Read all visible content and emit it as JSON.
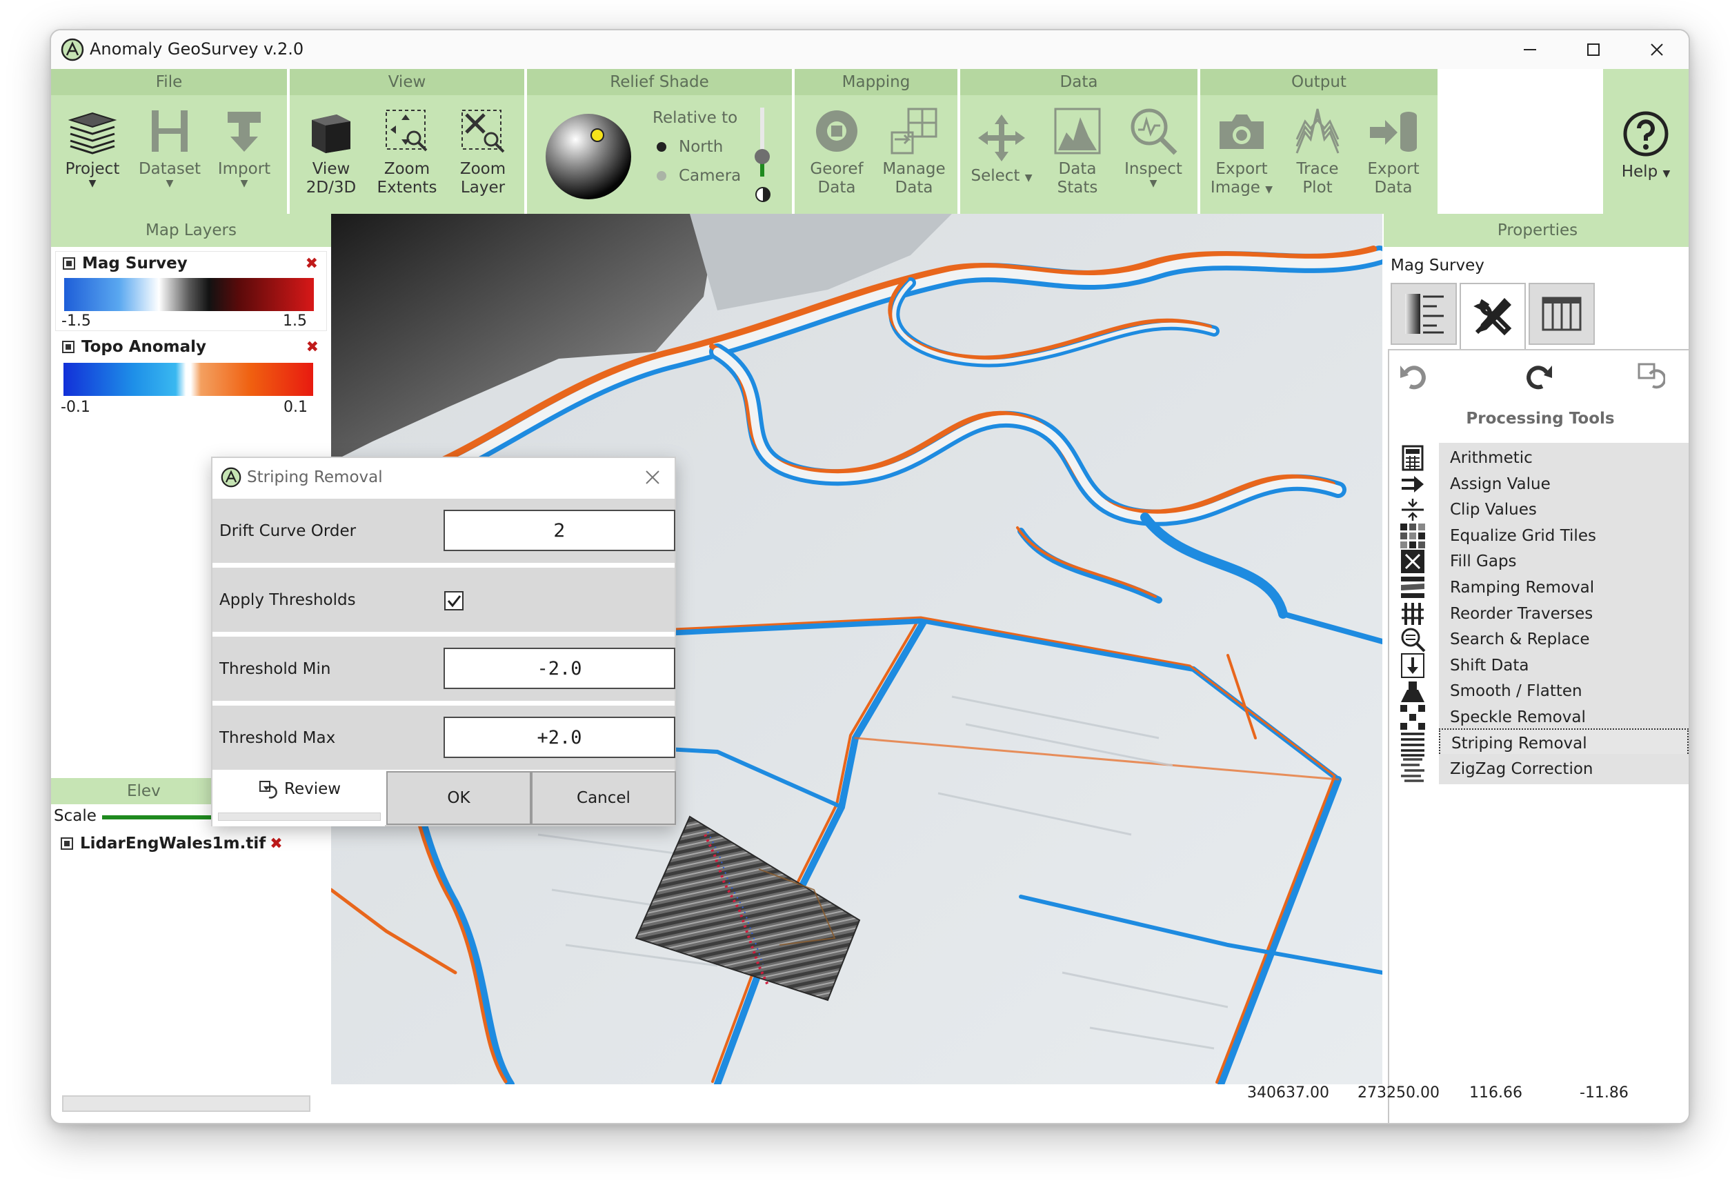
{
  "window": {
    "title": "Anomaly GeoSurvey v.2.0"
  },
  "ribbon": {
    "file": {
      "label": "File",
      "project": "Project",
      "dataset": "Dataset",
      "import": "Import"
    },
    "view": {
      "label": "View",
      "view2d3d_1": "View",
      "view2d3d_2": "2D/3D",
      "zoom_extents_1": "Zoom",
      "zoom_extents_2": "Extents",
      "zoom_layer_1": "Zoom",
      "zoom_layer_2": "Layer"
    },
    "relief": {
      "label": "Relief Shade",
      "relative_to": "Relative to",
      "north": "North",
      "camera": "Camera",
      "selected": "North"
    },
    "mapping": {
      "label": "Mapping",
      "georef_1": "Georef",
      "georef_2": "Data",
      "manage_1": "Manage",
      "manage_2": "Data"
    },
    "data": {
      "label": "Data",
      "select": "Select",
      "stats_1": "Data",
      "stats_2": "Stats",
      "inspect": "Inspect"
    },
    "output": {
      "label": "Output",
      "export_image_1": "Export",
      "export_image_2": "Image",
      "trace_1": "Trace",
      "trace_2": "Plot",
      "export_data_1": "Export",
      "export_data_2": "Data"
    },
    "help": {
      "label": "Help"
    }
  },
  "map_layers": {
    "title": "Map Layers",
    "layers": [
      {
        "name": "Mag Survey",
        "min": "-1.5",
        "max": "1.5"
      },
      {
        "name": "Topo Anomaly",
        "min": "-0.1",
        "max": "0.1"
      }
    ],
    "elevation_title": "Elev",
    "scale_label": "Scale",
    "elevation_layer": "LidarEngWales1m.tif"
  },
  "dialog": {
    "title": "Striping Removal",
    "drift_label": "Drift Curve Order",
    "drift_value": "2",
    "apply_label": "Apply Thresholds",
    "apply_checked": true,
    "min_label": "Threshold Min",
    "min_value": "-2.0",
    "max_label": "Threshold Max",
    "max_value": "+2.0",
    "review": "Review",
    "ok": "OK",
    "cancel": "Cancel"
  },
  "properties": {
    "title": "Properties",
    "layer": "Mag Survey",
    "tools_title": "Processing Tools",
    "tools": [
      {
        "label": "Arithmetic",
        "icon": "calculator-icon"
      },
      {
        "label": "Assign Value",
        "icon": "assign-arrow-icon"
      },
      {
        "label": "Clip Values",
        "icon": "clip-icon"
      },
      {
        "label": "Equalize Grid Tiles",
        "icon": "grid-tiles-icon"
      },
      {
        "label": "Fill Gaps",
        "icon": "fill-gaps-icon"
      },
      {
        "label": "Ramping Removal",
        "icon": "ramping-icon"
      },
      {
        "label": "Reorder Traverses",
        "icon": "reorder-icon"
      },
      {
        "label": "Search & Replace",
        "icon": "search-replace-icon"
      },
      {
        "label": "Shift Data",
        "icon": "shift-down-icon"
      },
      {
        "label": "Smooth / Flatten",
        "icon": "smooth-icon"
      },
      {
        "label": "Speckle Removal",
        "icon": "speckle-icon"
      },
      {
        "label": "Striping Removal",
        "icon": "striping-icon",
        "focused": true
      },
      {
        "label": "ZigZag Correction",
        "icon": "zigzag-icon"
      }
    ]
  },
  "status": {
    "x": "340637.00",
    "y": "273250.00",
    "z": "116.66",
    "value": "-11.86"
  },
  "colors": {
    "ribbon_green": "#c6e4b4",
    "ribbon_head": "#b5d7a0",
    "accent_blue": "#1e8be0",
    "accent_orange": "#e8661c"
  }
}
